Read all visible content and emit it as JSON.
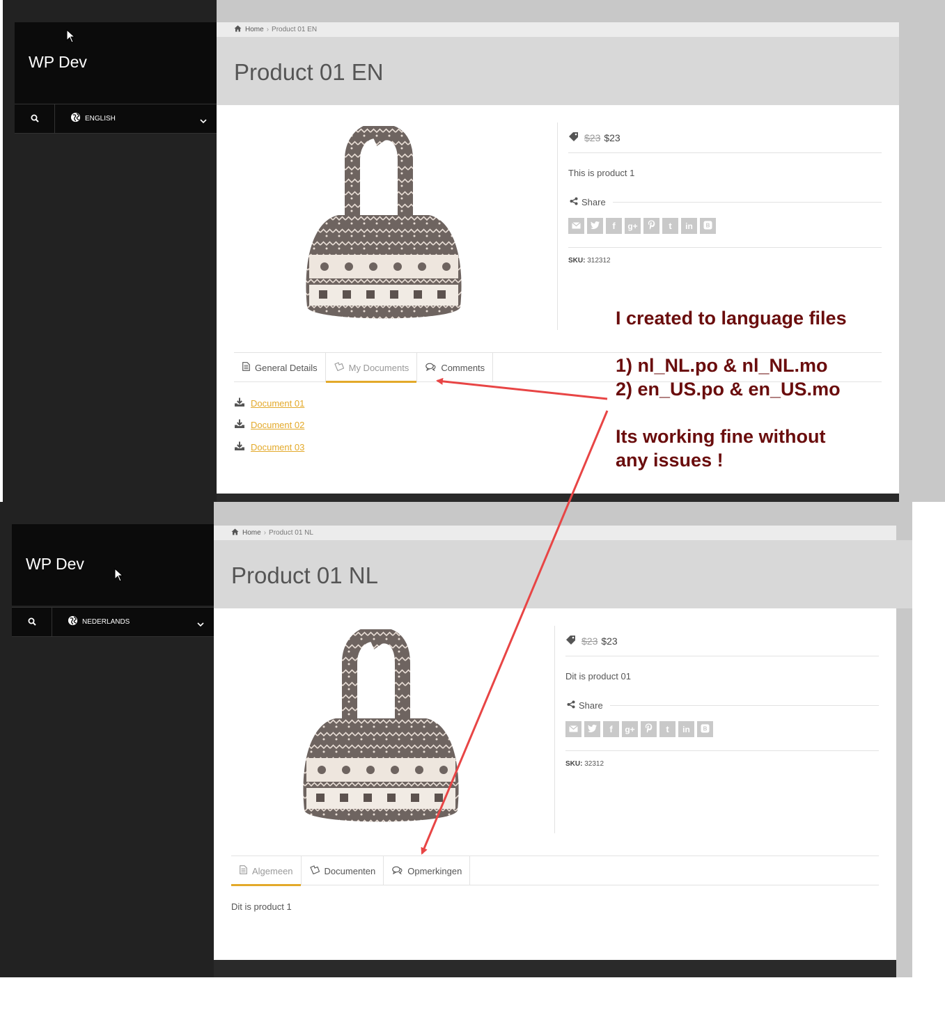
{
  "colors": {
    "accent": "#e3a92a",
    "annotation_text": "#6a0d0d",
    "arrow": "#e84545",
    "sidebar": "#222222",
    "brand_box": "#0b0b0b"
  },
  "screens": {
    "en": {
      "brand": "WP Dev",
      "language": "ENGLISH",
      "breadcrumb": {
        "home": "Home",
        "current": "Product 01 EN"
      },
      "title": "Product 01 EN",
      "price_old": "$23",
      "price_new": "$23",
      "description": "This is product 1",
      "share_label": "Share",
      "sku_label": "SKU:",
      "sku_value": "312312",
      "tabs": [
        {
          "label": "General Details",
          "icon": "document-icon"
        },
        {
          "label": "My Documents",
          "icon": "documents-icon"
        },
        {
          "label": "Comments",
          "icon": "comments-icon"
        }
      ],
      "active_tab": 1,
      "documents": [
        "Document 01",
        "Document 02",
        "Document 03"
      ]
    },
    "nl": {
      "brand": "WP Dev",
      "language": "NEDERLANDS",
      "breadcrumb": {
        "home": "Home",
        "current": "Product 01 NL"
      },
      "title": "Product 01 NL",
      "price_old": "$23",
      "price_new": "$23",
      "description": "Dit is product 01",
      "share_label": "Share",
      "sku_label": "SKU:",
      "sku_value": "32312",
      "tabs": [
        {
          "label": "Algemeen",
          "icon": "document-icon"
        },
        {
          "label": "Documenten",
          "icon": "documents-icon"
        },
        {
          "label": "Opmerkingen",
          "icon": "comments-icon"
        }
      ],
      "active_tab": 0,
      "tab_content": "Dit is product 1"
    }
  },
  "social_icons": [
    "email-icon",
    "twitter-icon",
    "facebook-icon",
    "google-plus-icon",
    "pinterest-icon",
    "tumblr-icon",
    "linkedin-icon",
    "blogger-icon"
  ],
  "annotation": {
    "line1": "I created to language files",
    "line2": "1) nl_NL.po & nl_NL.mo",
    "line3": "2) en_US.po & en_US.mo",
    "line4": "Its working fine without",
    "line5": "any issues !"
  }
}
